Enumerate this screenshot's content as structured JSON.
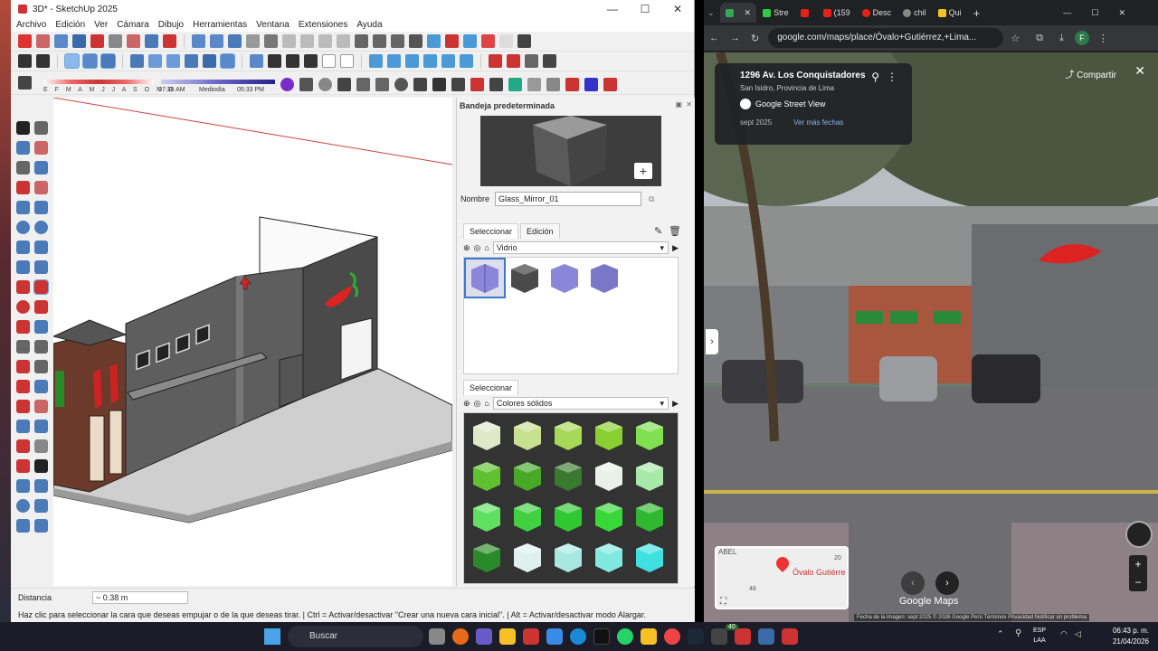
{
  "sketchup": {
    "title": "3D* - SketchUp 2025",
    "menu": [
      "Archivo",
      "Edición",
      "Ver",
      "Cámara",
      "Dibujo",
      "Herramientas",
      "Ventana",
      "Extensiones",
      "Ayuda"
    ],
    "shadow": {
      "months": "E F M A M J J A S O N D",
      "time_start": "07:35 AM",
      "midday": "Mediodía",
      "time_end": "05:33 PM"
    },
    "tray": {
      "title": "Bandeja predeterminada",
      "name_label": "Nombre",
      "material_name": "Glass_Mirror_01",
      "tab_select": "Seleccionar",
      "tab_edit": "Edición",
      "library1": "Vidrio",
      "select_label2": "Seleccionar",
      "library2": "Colores sólidos"
    },
    "status": {
      "distance_label": "Distancia",
      "distance_value": "~ 0.38 m",
      "hint": "Haz clic para seleccionar la cara que deseas empujar o de la que deseas tirar. | Ctrl = Activar/desactivar \"Crear una nueva cara inicial\". | Alt = Activar/desactivar modo Alargar."
    },
    "window_controls": [
      "—",
      "☐",
      "✕"
    ],
    "accent": "#6aa6e0"
  },
  "browser": {
    "tabs": [
      {
        "label": "",
        "color": "#34a853",
        "active": true
      },
      {
        "label": "Stre",
        "color": "#2ecc40",
        "active": false
      },
      {
        "label": "",
        "color": "#e62117",
        "active": false
      },
      {
        "label": "(159",
        "color": "#e62117",
        "active": false
      },
      {
        "label": "Desc",
        "color": "#e62117",
        "active": false
      },
      {
        "label": "chil",
        "color": "#888888",
        "active": false
      },
      {
        "label": "Qui",
        "color": "#f6c026",
        "active": false
      }
    ],
    "url": "google.com/maps/place/Óvalo+Gutiérrez,+Lima...",
    "profile": "F",
    "streetview": {
      "address": "1296 Av. Los Conquistadores",
      "district": "San Isidro, Provincia de Lima",
      "source": "Google Street View",
      "date": "sept 2025",
      "more_dates": "Ver más fechas",
      "share": "Compartir",
      "map_label": "Óvalo Gutiérre",
      "map_top": "ABEL",
      "map_num1": "20",
      "map_num2": "48",
      "brand": "Google Maps",
      "footer": "Fecha de la imagen: sept 2025   © 2026 Google   Perú   Términos   Privacidad   Notificar un problema"
    }
  },
  "taskbar": {
    "search": "Buscar",
    "lang": "ESP",
    "lang2": "LAA",
    "time": "06:43 p. m.",
    "date": "21/04/2026",
    "badge": "40"
  }
}
